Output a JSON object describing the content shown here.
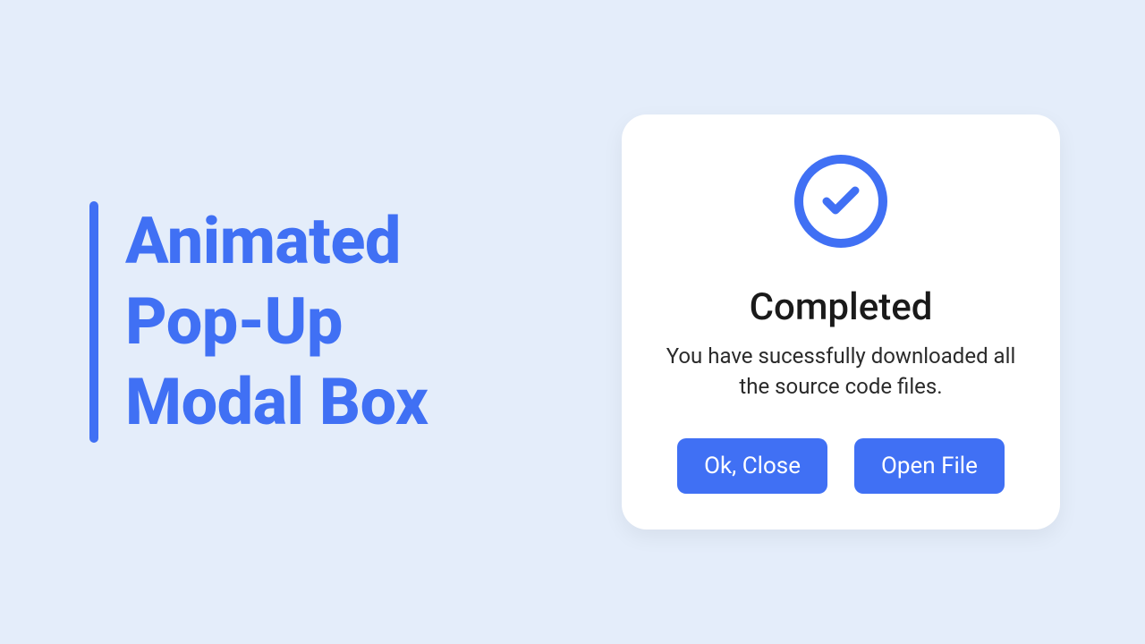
{
  "page_title": "Animated\nPop-Up\nModal Box",
  "modal": {
    "title": "Completed",
    "description": "You have sucessfully downloaded all the source code files.",
    "buttons": {
      "close": "Ok, Close",
      "open": "Open File"
    }
  },
  "colors": {
    "accent": "#4070f4",
    "background": "#e4edfa"
  }
}
